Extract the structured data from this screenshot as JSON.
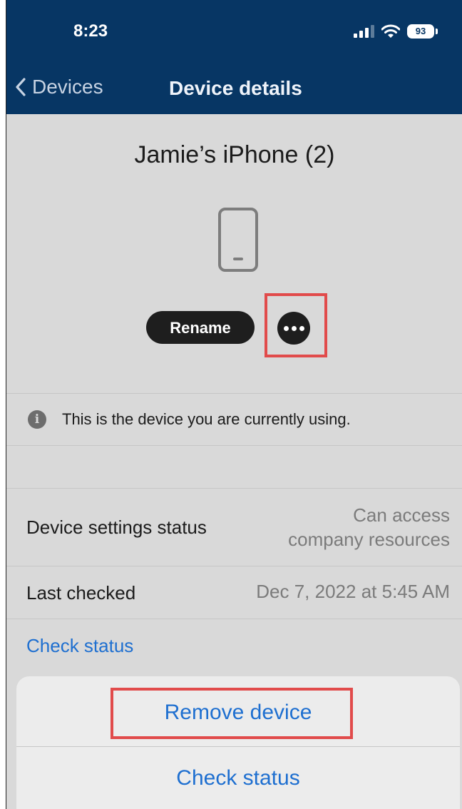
{
  "status_bar": {
    "time": "8:23",
    "battery": "93",
    "icons": [
      "signal-icon",
      "wifi-icon",
      "battery-icon"
    ]
  },
  "nav": {
    "back_label": "Devices",
    "title": "Device details"
  },
  "device": {
    "name": "Jamie’s iPhone (2)",
    "icon": "phone-icon",
    "rename_label": "Rename",
    "more_icon": "ellipsis-icon"
  },
  "info": {
    "icon": "info-icon",
    "text": "This is the device you are currently using."
  },
  "details": {
    "settings_status_label": "Device settings status",
    "settings_status_value_line1": "Can access",
    "settings_status_value_line2": "company resources",
    "last_checked_label": "Last checked",
    "last_checked_value": "Dec 7, 2022 at 5:45 AM",
    "check_status_link": "Check status"
  },
  "action_sheet": {
    "remove_device": "Remove device",
    "check_status": "Check status"
  },
  "colors": {
    "header": "#073664",
    "link": "#1e6fd0",
    "highlight": "#e14b4b",
    "background": "#d9d9d9"
  }
}
